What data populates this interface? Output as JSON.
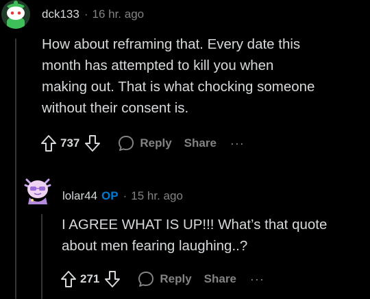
{
  "comments": [
    {
      "username": "dck133",
      "op_badge": "",
      "separator": "·",
      "time": "16 hr. ago",
      "body_lines": [
        "How about reframing that. Every date this",
        "month has attempted to kill you when",
        "making out. That is what chocking someone",
        "without their consent is."
      ],
      "votes": "737",
      "reply_label": "Reply",
      "share_label": "Share",
      "more_label": "···"
    },
    {
      "username": "lolar44",
      "op_badge": "OP",
      "separator": "·",
      "time": "15 hr. ago",
      "body_lines": [
        "I AGREE WHAT IS UP!!! What’s that quote",
        "about men fearing laughing..?"
      ],
      "votes": "271",
      "reply_label": "Reply",
      "share_label": "Share",
      "more_label": "···"
    }
  ],
  "colors": {
    "background": "#000000",
    "text": "#d7dadc",
    "muted": "#818384",
    "op_blue": "#0079d3",
    "thread_line": "#343536"
  }
}
